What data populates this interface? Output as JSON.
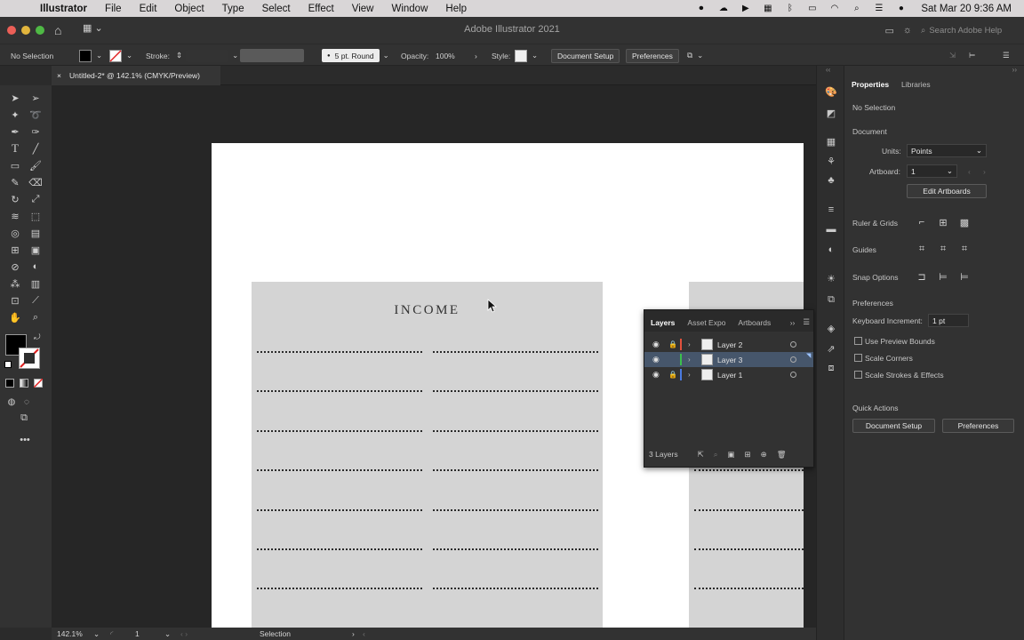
{
  "menubar": {
    "app_name": "Illustrator",
    "items": [
      "File",
      "Edit",
      "Object",
      "Type",
      "Select",
      "Effect",
      "View",
      "Window",
      "Help"
    ],
    "clock": "Sat Mar 20  9:36 AM"
  },
  "titlebar": {
    "title": "Adobe Illustrator 2021",
    "search_placeholder": "Search Adobe Help"
  },
  "controlbar": {
    "selection": "No Selection",
    "stroke_label": "Stroke:",
    "brush": "5 pt. Round",
    "opacity_label": "Opacity:",
    "opacity_value": "100%",
    "style_label": "Style:",
    "document_setup": "Document Setup",
    "preferences": "Preferences"
  },
  "document": {
    "tab_title": "Untitled-2* @ 142.1% (CMYK/Preview)",
    "close": "×"
  },
  "artwork": {
    "heading": "INCOME"
  },
  "layers_panel": {
    "tabs": [
      "Layers",
      "Asset Expo",
      "Artboards"
    ],
    "layers": [
      {
        "name": "Layer 2",
        "color": "#e2513d",
        "selected": false
      },
      {
        "name": "Layer 3",
        "color": "#3bbf4d",
        "selected": true
      },
      {
        "name": "Layer 1",
        "color": "#4a7ae0",
        "selected": false
      }
    ],
    "count": "3 Layers"
  },
  "properties": {
    "tabs": [
      "Properties",
      "Libraries"
    ],
    "no_selection": "No Selection",
    "document_heading": "Document",
    "units_label": "Units:",
    "units_value": "Points",
    "artboard_label": "Artboard:",
    "artboard_value": "1",
    "edit_artboards": "Edit Artboards",
    "ruler_grids": "Ruler & Grids",
    "guides": "Guides",
    "snap_options": "Snap Options",
    "preferences_heading": "Preferences",
    "keyboard_increment_label": "Keyboard Increment:",
    "keyboard_increment_value": "1 pt",
    "use_preview_bounds": "Use Preview Bounds",
    "scale_corners": "Scale Corners",
    "scale_strokes": "Scale Strokes & Effects",
    "quick_actions": "Quick Actions",
    "document_setup": "Document Setup",
    "preferences": "Preferences"
  },
  "statusbar": {
    "zoom": "142.1%",
    "artboard": "1",
    "tool": "Selection"
  }
}
